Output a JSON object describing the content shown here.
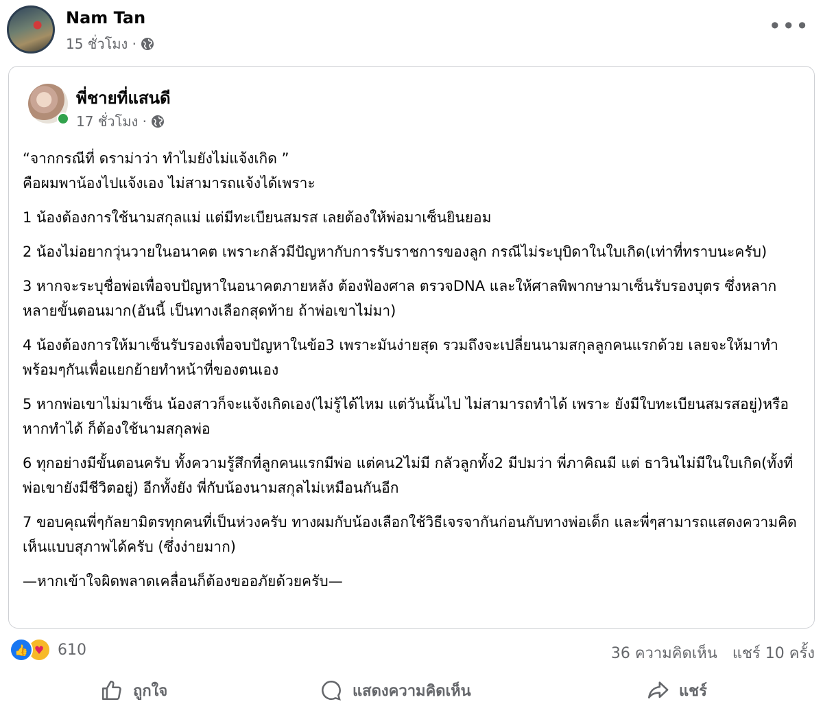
{
  "post": {
    "author": "Nam Tan",
    "time": "15 ชั่วโมง ·"
  },
  "shared": {
    "author": "พี่ชายที่แสนดี",
    "time": "17 ชั่วโมง ·",
    "intro_line1": "“จากกรณีที่ ดราม่าว่า ทำไมยังไม่แจ้งเกิด ”",
    "intro_line2": "คือผมพาน้องไปแจ้งเอง ไม่สามารถแจ้งได้เพราะ",
    "items": [
      "1 น้องต้องการใช้นามสกุลแม่ แต่มีทะเบียนสมรส เลยต้องให้พ่อมาเซ็นยินยอม",
      "2 น้องไม่อยากวุ่นวายในอนาคต เพราะกลัวมีปัญหากับการรับราชการของลูก กรณีไม่ระบุบิดาในใบเกิด(เท่าที่ทราบนะครับ)",
      "3 หากจะระบุชื่อพ่อเพื่อจบปัญหาในอนาคตภายหลัง ต้องฟ้องศาล ตรวจDNA และให้ศาลพิพากษามาเซ็นรับรองบุตร ซึ่งหลากหลายขั้นตอนมาก(อันนี้ เป็นทางเลือกสุดท้าย ถ้าพ่อเขาไม่มา)",
      "4 น้องต้องการให้มาเซ็นรับรองเพื่อจบปัญหาในข้อ3 เพราะมันง่ายสุด รวมถึงจะเปลี่ยนนามสกุลลูกคนแรกด้วย เลยจะให้มาทำพร้อมๆกันเพื่อแยกย้ายทำหน้าที่ของตนเอง",
      "5 หากพ่อเขาไม่มาเซ็น น้องสาวก็จะแจ้งเกิดเอง(ไม่รู้ได้ไหม แต่วันนั้นไป ไม่สามารถทำได้ เพราะ ยังมีใบทะเบียนสมรสอยู่)หรือหากทำได้ ก็ต้องใช้นามสกุลพ่อ",
      "6 ทุกอย่างมีขั้นตอนครับ ทั้งความรู้สึกที่ลูกคนแรกมีพ่อ แต่คน2ไม่มี กลัวลูกทั้ง2 มีปมว่า พี่ภาคิณมี แต่ ธาวินไม่มีในใบเกิด(ทั้งที่พ่อเขายังมีชีวิตอยู่) อีกทั้งยัง พี่กับน้องนามสกุลไม่เหมือนกันอีก",
      "7 ขอบคุณพี่ๆกัลยามิตรทุกคนที่เป็นห่วงครับ ทางผมกับน้องเลือกใช้วิธีเจรจากันก่อนกับทางพ่อเด็ก และพี่ๆสามารถแสดงความคิดเห็นแบบสุภาพได้ครับ (ซึ่งง่ายมาก)"
    ],
    "closing": "—หากเข้าใจผิดพลาดเคลื่อนก็ต้องขออภัยด้วยครับ—"
  },
  "engagement": {
    "reaction_count": "610",
    "comments": "36 ความคิดเห็น",
    "shares": "แชร์ 10 ครั้ง"
  },
  "actions": {
    "like": "ถูกใจ",
    "comment": "แสดงความคิดเห็น",
    "share": "แชร์"
  },
  "icons": {
    "privacy": "globe-icon",
    "more": "more-options-icon",
    "like_reaction": "thumbs-up-icon",
    "care_reaction": "care-icon"
  },
  "colors": {
    "accent": "#1877f2",
    "online": "#31a24c",
    "secondary_text": "#65676b"
  }
}
